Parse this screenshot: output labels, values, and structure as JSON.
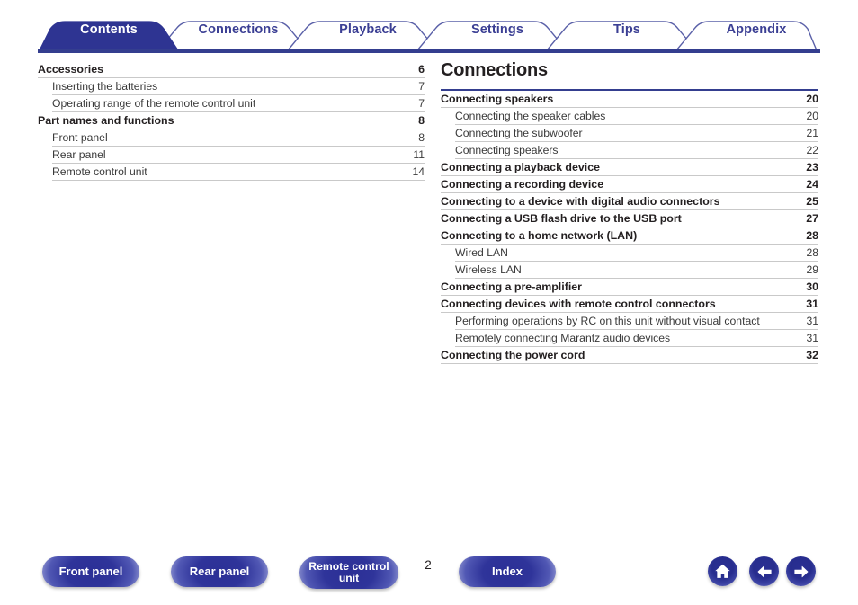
{
  "colors": {
    "brand_blue": "#333c8f",
    "tab_active_bg": "#2e3492",
    "tab_inactive_text": "#3b3f94",
    "rule_gray": "#c9c9c9",
    "text": "#231f20"
  },
  "tabs": [
    {
      "label": "Contents",
      "active": true
    },
    {
      "label": "Connections",
      "active": false
    },
    {
      "label": "Playback",
      "active": false
    },
    {
      "label": "Settings",
      "active": false
    },
    {
      "label": "Tips",
      "active": false
    },
    {
      "label": "Appendix",
      "active": false
    }
  ],
  "left_column": {
    "entries": [
      {
        "level": 1,
        "title": "Accessories",
        "page": "6"
      },
      {
        "level": 2,
        "title": "Inserting the batteries",
        "page": "7"
      },
      {
        "level": 2,
        "title": "Operating range of the remote control unit",
        "page": "7"
      },
      {
        "level": 1,
        "title": "Part names and functions",
        "page": "8"
      },
      {
        "level": 2,
        "title": "Front panel",
        "page": "8"
      },
      {
        "level": 2,
        "title": "Rear panel",
        "page": "11"
      },
      {
        "level": 2,
        "title": "Remote control unit",
        "page": "14"
      }
    ]
  },
  "right_column": {
    "heading": "Connections",
    "entries": [
      {
        "level": 1,
        "title": "Connecting speakers",
        "page": "20"
      },
      {
        "level": 2,
        "title": "Connecting the speaker cables",
        "page": "20"
      },
      {
        "level": 2,
        "title": "Connecting the subwoofer",
        "page": "21"
      },
      {
        "level": 2,
        "title": "Connecting speakers",
        "page": "22"
      },
      {
        "level": 1,
        "title": "Connecting a playback device",
        "page": "23"
      },
      {
        "level": 1,
        "title": "Connecting a recording device",
        "page": "24"
      },
      {
        "level": 1,
        "title": "Connecting to a device with digital audio connectors",
        "page": "25"
      },
      {
        "level": 1,
        "title": "Connecting a USB flash drive to the USB port",
        "page": "27"
      },
      {
        "level": 1,
        "title": "Connecting to a home network (LAN)",
        "page": "28"
      },
      {
        "level": 2,
        "title": "Wired LAN",
        "page": "28"
      },
      {
        "level": 2,
        "title": "Wireless LAN",
        "page": "29"
      },
      {
        "level": 1,
        "title": "Connecting a pre-amplifier",
        "page": "30"
      },
      {
        "level": 1,
        "title": "Connecting devices with remote control connectors",
        "page": "31"
      },
      {
        "level": 2,
        "title": "Performing operations by RC on this unit without visual contact",
        "page": "31"
      },
      {
        "level": 2,
        "title": "Remotely connecting Marantz audio devices",
        "page": "31"
      },
      {
        "level": 1,
        "title": "Connecting the power cord",
        "page": "32"
      }
    ]
  },
  "footer": {
    "page_number": "2",
    "buttons": [
      {
        "label": "Front panel",
        "name": "front-panel-button"
      },
      {
        "label": "Rear panel",
        "name": "rear-panel-button"
      },
      {
        "label": "Remote control unit",
        "name": "remote-control-unit-button"
      },
      {
        "label": "Index",
        "name": "index-button"
      }
    ],
    "nav_icons": [
      {
        "icon": "home-icon",
        "name": "home-button"
      },
      {
        "icon": "arrow-left-icon",
        "name": "previous-page-button"
      },
      {
        "icon": "arrow-right-icon",
        "name": "next-page-button"
      }
    ]
  }
}
